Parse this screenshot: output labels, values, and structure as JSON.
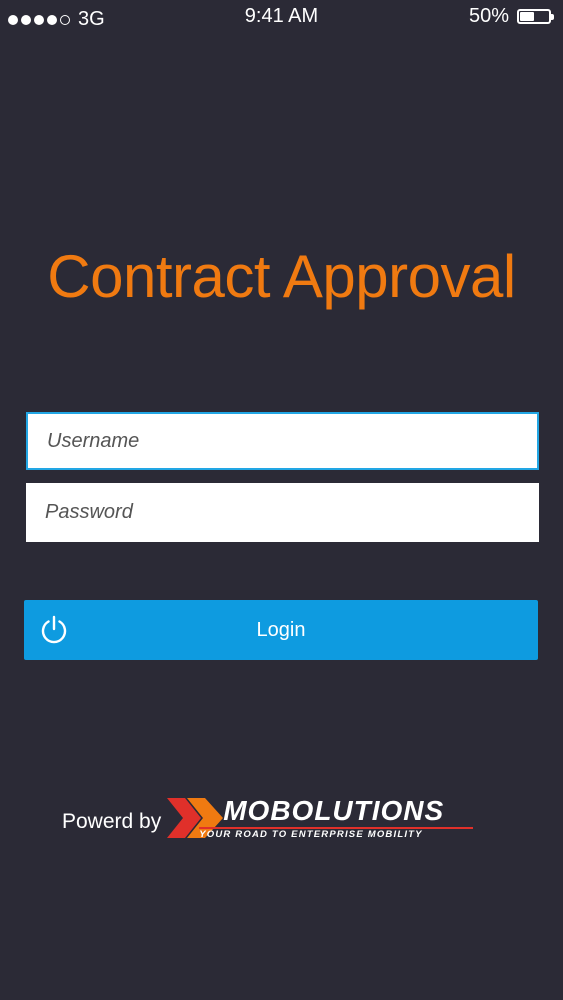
{
  "status_bar": {
    "network": "3G",
    "time": "9:41 AM",
    "battery_percent": "50%",
    "battery_level": 0.5,
    "signal_bars_filled": 4,
    "signal_bars_total": 5
  },
  "app": {
    "title": "Contract Approval",
    "title_color": "#f07a11",
    "background_color": "#2b2a36"
  },
  "form": {
    "username_placeholder": "Username",
    "username_value": "",
    "password_placeholder": "Password",
    "password_value": "",
    "login_label": "Login",
    "login_icon": "power-icon",
    "accent_color": "#0e9be0"
  },
  "footer": {
    "powered_by": "Powerd by",
    "brand_name": "MOBOLUTIONS",
    "tagline": "YOUR ROAD TO ENTERPRISE MOBILITY"
  }
}
